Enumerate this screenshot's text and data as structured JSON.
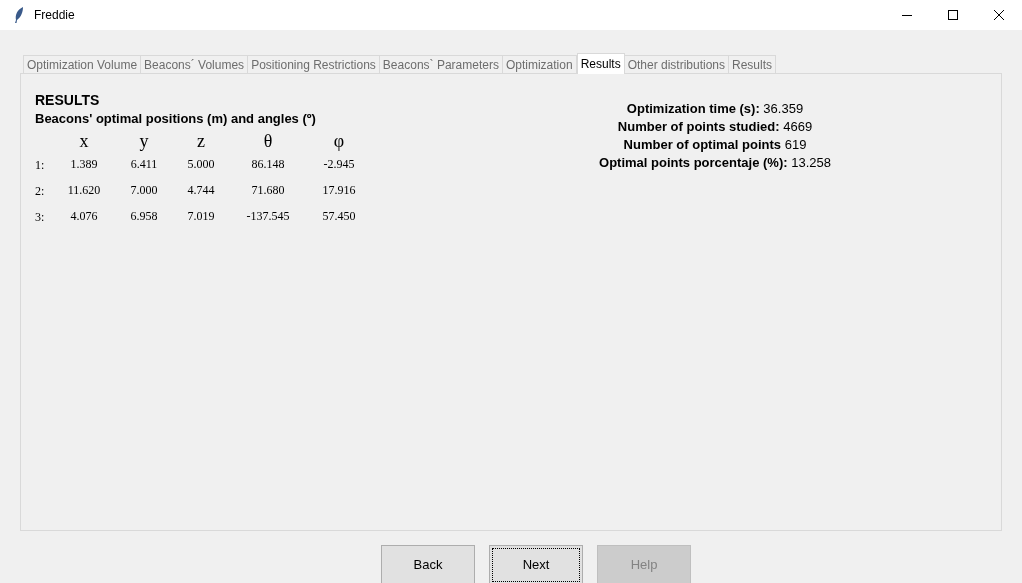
{
  "window": {
    "title": "Freddie"
  },
  "tabs": [
    {
      "label": "Optimization Volume",
      "selected": false
    },
    {
      "label": "Beacons´ Volumes",
      "selected": false
    },
    {
      "label": "Positioning Restrictions",
      "selected": false
    },
    {
      "label": "Beacons` Parameters",
      "selected": false
    },
    {
      "label": "Optimization",
      "selected": false
    },
    {
      "label": "Results",
      "selected": true
    },
    {
      "label": "Other distributions",
      "selected": false
    },
    {
      "label": "Results",
      "selected": false
    }
  ],
  "heading": "RESULTS",
  "subheading": "Beacons' optimal positions (m) and angles (º)",
  "table": {
    "columns": [
      "x",
      "y",
      "z",
      "θ",
      "φ"
    ],
    "rows": [
      {
        "index": "1:",
        "cells": [
          "1.389",
          "6.411",
          "5.000",
          "86.148",
          "-2.945"
        ]
      },
      {
        "index": "2:",
        "cells": [
          "11.620",
          "7.000",
          "4.744",
          "71.680",
          "17.916"
        ]
      },
      {
        "index": "3:",
        "cells": [
          "4.076",
          "6.958",
          "7.019",
          "-137.545",
          "57.450"
        ]
      }
    ]
  },
  "stats": [
    "**Optimization time (s):** 36.359",
    "**Number of points studied:** 4669",
    "**Number of optimal points** 619",
    "**Optimal points porcentaje (%):** 13.258"
  ],
  "buttons": [
    {
      "label": "Back",
      "focused": false,
      "disabled": false
    },
    {
      "label": "Next",
      "focused": true,
      "disabled": false
    },
    {
      "label": "Help",
      "focused": false,
      "disabled": true
    }
  ]
}
